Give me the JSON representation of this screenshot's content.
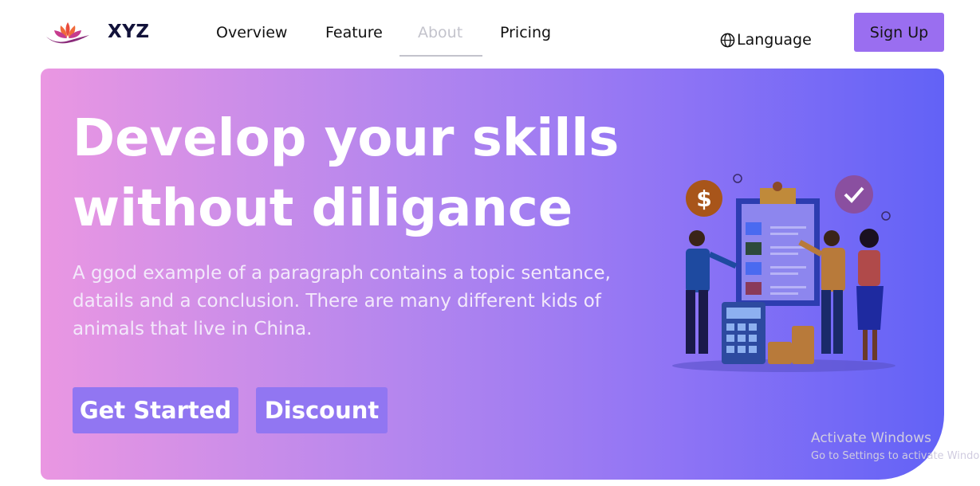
{
  "nav": {
    "brand": "XYZ",
    "items": [
      {
        "label": "Overview",
        "active": false
      },
      {
        "label": "Feature",
        "active": false
      },
      {
        "label": "About",
        "active": true
      },
      {
        "label": "Pricing",
        "active": false
      }
    ],
    "language_label": "Language",
    "language_icon": "globe-icon",
    "signup_label": "Sign Up"
  },
  "hero": {
    "title_line1": "Develop your skills",
    "title_line2": "without diligance",
    "paragraph": "A ggod example of a paragraph contains a topic sentance, datails and a conclusion. There are many different kids of animals that live in China.",
    "primary_button": "Get Started",
    "secondary_button": "Discount",
    "illustration": "people-with-checklist-illustration"
  },
  "watermark": {
    "title": "Activate Windows",
    "subtitle": "Go to Settings to activate Windows."
  },
  "colors": {
    "accent": "#9a6ef0",
    "gradient_start": "#ea97e2",
    "gradient_end": "#6262f6",
    "brand_text": "#12123a"
  }
}
